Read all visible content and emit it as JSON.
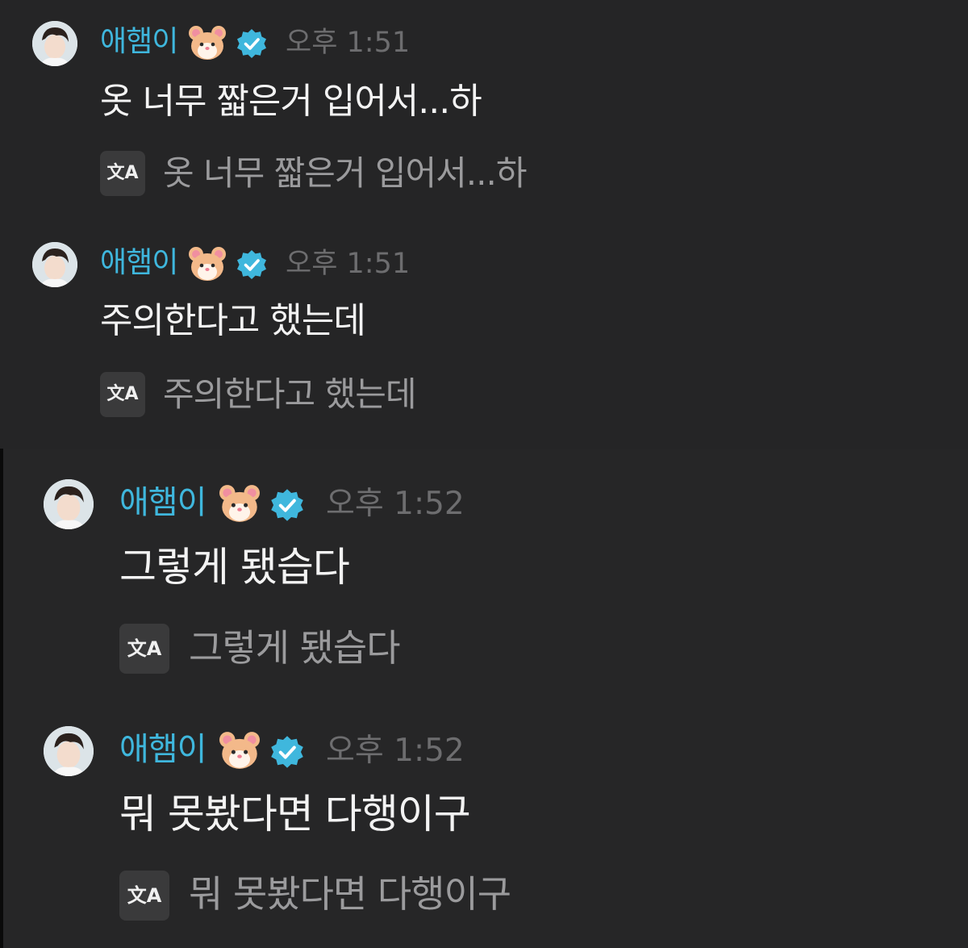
{
  "messages": [
    {
      "username": "애햄이",
      "time": "오후 1:51",
      "text": "옷 너무 짧은거 입어서...하",
      "translation_icon_label": "文A",
      "translation": "옷 너무 짧은거 입어서...하"
    },
    {
      "username": "애햄이",
      "time": "오후 1:51",
      "text": "주의한다고 했는데",
      "translation_icon_label": "文A",
      "translation": "주의한다고 했는데"
    },
    {
      "username": "애햄이",
      "time": "오후 1:52",
      "text": "그렇게 됐습다",
      "translation_icon_label": "文A",
      "translation": "그렇게 됐습다"
    },
    {
      "username": "애햄이",
      "time": "오후 1:52",
      "text": "뭐 못봤다면 다행이구",
      "translation_icon_label": "文A",
      "translation": "뭐 못봤다면 다행이구"
    }
  ],
  "icons": {
    "avatar": "avatar-photo",
    "name_emoji": "hamster-icon",
    "badge": "verified-badge-icon",
    "translate": "translate-icon"
  },
  "colors": {
    "background": "#252526",
    "username": "#3fb7dd",
    "badge": "#3fb7dd",
    "time": "#6d6d6f",
    "message_text": "#f3f3f3",
    "translation_text": "#9b9b9d"
  }
}
